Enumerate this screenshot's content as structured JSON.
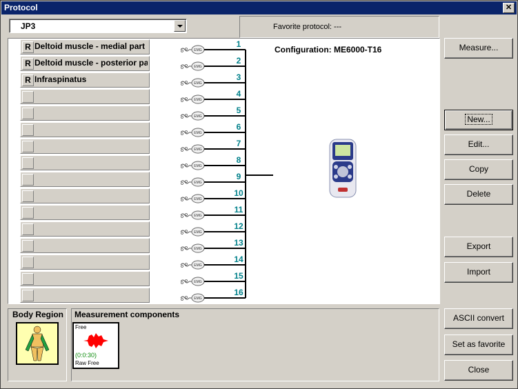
{
  "window": {
    "title": "Protocol",
    "close_label": "✕"
  },
  "protocol_select": {
    "value": "JP3"
  },
  "favorite": {
    "label": "Favorite protocol:",
    "value": "---"
  },
  "favorite_text": "Favorite protocol:  ---",
  "configuration": {
    "text": "Configuration:  ME6000-T16"
  },
  "muscles": [
    {
      "r": "R",
      "label": "Deltoid muscle - medial part"
    },
    {
      "r": "R",
      "label": "Deltoid muscle - posterior part"
    },
    {
      "r": "R",
      "label": "Infraspinatus"
    },
    {
      "r": "",
      "label": ""
    },
    {
      "r": "",
      "label": ""
    },
    {
      "r": "",
      "label": ""
    },
    {
      "r": "",
      "label": ""
    },
    {
      "r": "",
      "label": ""
    },
    {
      "r": "",
      "label": ""
    },
    {
      "r": "",
      "label": ""
    },
    {
      "r": "",
      "label": ""
    },
    {
      "r": "",
      "label": ""
    },
    {
      "r": "",
      "label": ""
    },
    {
      "r": "",
      "label": ""
    },
    {
      "r": "",
      "label": ""
    },
    {
      "r": "",
      "label": ""
    }
  ],
  "channels": [
    "1",
    "2",
    "3",
    "4",
    "5",
    "6",
    "7",
    "8",
    "9",
    "10",
    "11",
    "12",
    "13",
    "14",
    "15",
    "16"
  ],
  "sensor_label": "EMG",
  "buttons": {
    "measure": "Measure...",
    "new": "New...",
    "edit": "Edit...",
    "copy": "Copy",
    "delete": "Delete",
    "export": "Export",
    "import": "Import",
    "ascii": "ASCII convert",
    "favorite": "Set as favorite",
    "close": "Close"
  },
  "body_region": {
    "title": "Body Region"
  },
  "measurement": {
    "title": "Measurement components",
    "tile_top": "Free",
    "tile_duration": "(0:0:30)",
    "tile_bottom": "Raw Free"
  },
  "colors": {
    "channel_number": "#00808a",
    "titlebar": "#0a246a",
    "tile_signal": "#ff0000"
  }
}
